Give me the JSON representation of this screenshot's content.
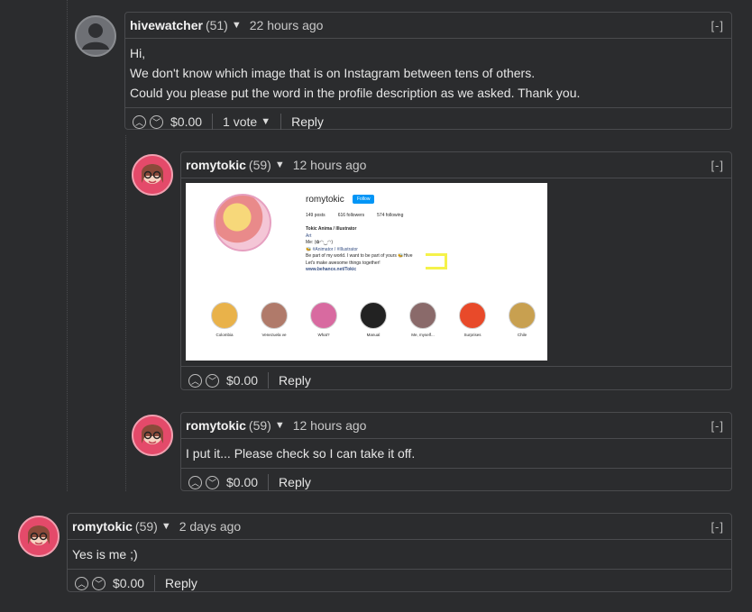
{
  "collapse_label": "[-]",
  "comments": [
    {
      "author": "hivewatcher",
      "reputation": "(51)",
      "time": "22 hours ago",
      "body": [
        "Hi,",
        "We don't know which image that is on Instagram between tens of others.",
        "Could you please put the word in the profile description as we asked. Thank you."
      ],
      "payout": "$0.00",
      "votes": "1 vote",
      "reply": "Reply"
    },
    {
      "author": "romytokic",
      "reputation": "(59)",
      "time": "12 hours ago",
      "payout": "$0.00",
      "reply": "Reply",
      "embed": {
        "username": "romytokic",
        "follow": "Follow",
        "stats": [
          "149 posts",
          "616 followers",
          "574 following"
        ],
        "bio": [
          "Tokic Anima / Illustrator",
          "Art",
          "Me: (✿◠‿◠)",
          "🐝 #Animator / #Illustrator",
          "Be part of my world. I want to be part of yours 🐝Hive",
          "Let's make awesome things together!",
          "www.behance.net/Tokic"
        ],
        "stories": [
          "Colombia",
          "Venezuela ve",
          "What?",
          "Manual",
          "Me, myself...",
          "Surprises",
          "Chile"
        ],
        "story_colors": [
          "#e9b24a",
          "#b07a6a",
          "#d86aa0",
          "#222222",
          "#8a6a6a",
          "#e84a2a",
          "#c8a050"
        ]
      }
    },
    {
      "author": "romytokic",
      "reputation": "(59)",
      "time": "12 hours ago",
      "body": [
        "I put it... Please check so I can take it off."
      ],
      "payout": "$0.00",
      "reply": "Reply"
    },
    {
      "author": "romytokic",
      "reputation": "(59)",
      "time": "2 days ago",
      "body": [
        "Yes is me ;)"
      ],
      "payout": "$0.00",
      "reply": "Reply"
    }
  ]
}
